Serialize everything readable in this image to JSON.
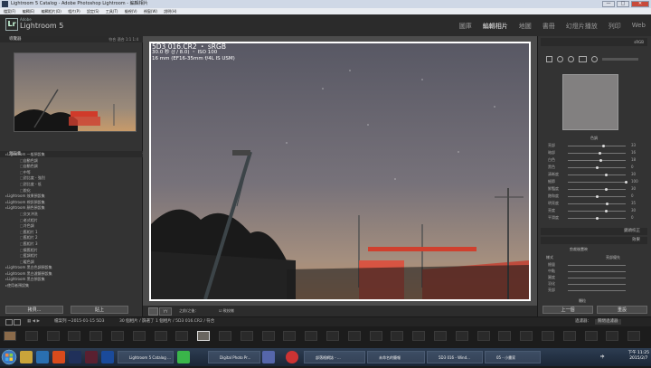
{
  "window": {
    "title": "Lightroom 5 Catalog - Adobe Photoshop Lightroom - 編輯相片",
    "controls": [
      "—",
      "□",
      "✕"
    ]
  },
  "menubar": [
    "檔案(F)",
    "編輯(E)",
    "編輯相片(D)",
    "相片(P)",
    "設定(S)",
    "工具(T)",
    "檢視(V)",
    "視窗(W)",
    "說明(H)"
  ],
  "header": {
    "logo": "Lr",
    "brand_small": "Adobe",
    "brand": "Lightroom 5",
    "modules": [
      "圖庫",
      "編輯相片",
      "地圖",
      "書冊",
      "幻燈片播放",
      "列印",
      "Web"
    ],
    "active_module": "編輯相片"
  },
  "left_panel": {
    "navigator_title": "導覽器",
    "navigator_opts": "符合  適合  1:1  1:4",
    "presets_title": "預設集",
    "presets": [
      {
        "label": "Lightroom 一般預設集",
        "kind": "folder"
      },
      {
        "label": "自動色調",
        "kind": "item"
      },
      {
        "label": "自動色調",
        "kind": "item"
      },
      {
        "label": "中等",
        "kind": "item"
      },
      {
        "label": "對比度 - 強烈",
        "kind": "item"
      },
      {
        "label": "對比度 - 低",
        "kind": "item"
      },
      {
        "label": "銳化",
        "kind": "item"
      },
      {
        "label": "Lightroom 效果預設集",
        "kind": "folder"
      },
      {
        "label": "Lightroom 視訊預設集",
        "kind": "folder"
      },
      {
        "label": "Lightroom 顏色預設集",
        "kind": "folder"
      },
      {
        "label": "交叉沖洗",
        "kind": "item"
      },
      {
        "label": "老式相片",
        "kind": "item"
      },
      {
        "label": "冷色調",
        "kind": "item"
      },
      {
        "label": "舊相片 1",
        "kind": "item"
      },
      {
        "label": "舊相片 2",
        "kind": "item"
      },
      {
        "label": "舊相片 3",
        "kind": "item"
      },
      {
        "label": "懷舊相片",
        "kind": "item"
      },
      {
        "label": "藍調相片",
        "kind": "item"
      },
      {
        "label": "暖色調",
        "kind": "item"
      },
      {
        "label": "Lightroom 黑白色調預設集",
        "kind": "folder"
      },
      {
        "label": "Lightroom 黑白濾鏡預設集",
        "kind": "folder"
      },
      {
        "label": "Lightroom 黑白預設集",
        "kind": "folder"
      },
      {
        "label": "使用者預設集",
        "kind": "folder"
      }
    ],
    "copy_button": "拷貝...",
    "paste_button": "貼上"
  },
  "photo": {
    "filename": "5D3 016.CR2 ・ sRGB",
    "exposure": "30.0 秒 (ƒ / 8.0) ・ ISO 100",
    "lens": "16 mm (EF16-35mm f/4L IS USM)"
  },
  "toolbar": {
    "before_after": "之前/之後：",
    "soft_proof_label": "軟校樣"
  },
  "right_panel": {
    "histogram_label": "sRGB",
    "tone_header": "色調",
    "sliders": [
      {
        "name": "亮部",
        "value": "33",
        "pos": 0.62
      },
      {
        "name": "暗部",
        "value": "16",
        "pos": 0.56
      },
      {
        "name": "白色",
        "value": "18",
        "pos": 0.57
      },
      {
        "name": "黑色",
        "value": "0",
        "pos": 0.5
      },
      {
        "name": "清晰度",
        "value": "30",
        "pos": 0.66
      },
      {
        "name": "細節",
        "value": "100",
        "pos": 1.0
      },
      {
        "name": "鮮豔度",
        "value": "30",
        "pos": 0.66
      },
      {
        "name": "飽和度",
        "value": "0",
        "pos": 0.5
      },
      {
        "name": "明亮度",
        "value": "35",
        "pos": 0.68
      },
      {
        "name": "亮度",
        "value": "30",
        "pos": 0.66
      },
      {
        "name": "平滑度",
        "value": "0",
        "pos": 0.5
      }
    ],
    "section_presence": "外觀",
    "section_lens": "鏡頭校正",
    "section_effects": "效果",
    "post_crop": "剪裁後暈映",
    "style_label": "樣式",
    "style_value": "亮部優先",
    "effect_sliders": [
      "總量",
      "中點",
      "圓度",
      "羽化",
      "亮部"
    ],
    "grain": "顆粒",
    "prev_button": "上一個",
    "reset_button": "重設"
  },
  "filmstrip": {
    "page_info": "檔案列 ~2015-01-15 5D3",
    "count": "30 個相片 / 篩選了 1 個相片 / 5D3 016.CR2 / 符合",
    "filter_label": "過濾器：",
    "filter_value": "關閉過濾器"
  },
  "taskbar": {
    "apps": [
      "Lightroom 5 Catalog ...",
      "Digital Photo Pr...",
      "部落格網誌 - ...",
      "未命名的簡報",
      "5D3 016 - Wind...",
      "05 - 小畫家"
    ],
    "time": "下午 11:25",
    "date": "2015/2/7",
    "lang": "中"
  }
}
